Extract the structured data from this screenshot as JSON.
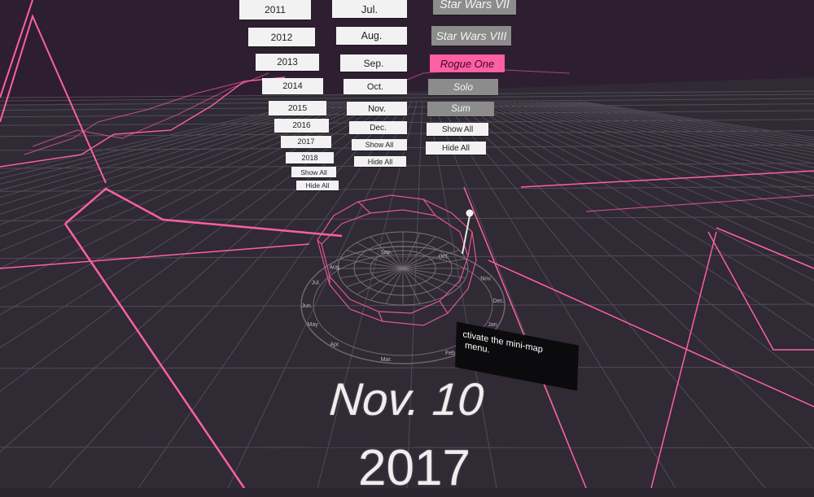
{
  "menus": {
    "years": [
      "2011",
      "2012",
      "2013",
      "2014",
      "2015",
      "2016",
      "2017",
      "2018"
    ],
    "years_show_all": "Show All",
    "years_hide_all": "Hide All",
    "months": [
      "Jul.",
      "Aug.",
      "Sep.",
      "Oct.",
      "Nov.",
      "Dec."
    ],
    "months_show_all": "Show All",
    "months_hide_all": "Hide All",
    "movies": [
      "Star Wars VII",
      "Star Wars VIII",
      "Rogue One",
      "Solo",
      "Sum"
    ],
    "movies_active": "Rogue One",
    "movies_show_all": "Show All",
    "movies_hide_all": "Hide All"
  },
  "radial": {
    "month_labels": [
      "Jan.",
      "Feb.",
      "Mar.",
      "Apr.",
      "May",
      "Jun.",
      "Jul.",
      "Aug.",
      "Sep.",
      "Oct.",
      "Nov.",
      "Dec."
    ]
  },
  "tooltip": {
    "text": "ctivate the mini-map\n menu."
  },
  "date_display": {
    "day": "Nov. 10",
    "year": "2017"
  },
  "colors": {
    "background": "#2b2530",
    "accent": "#ff5fa3",
    "active_button": "#ff5fa3",
    "inactive_movie_button": "#8c8c8c",
    "button": "#f2f2f2"
  }
}
